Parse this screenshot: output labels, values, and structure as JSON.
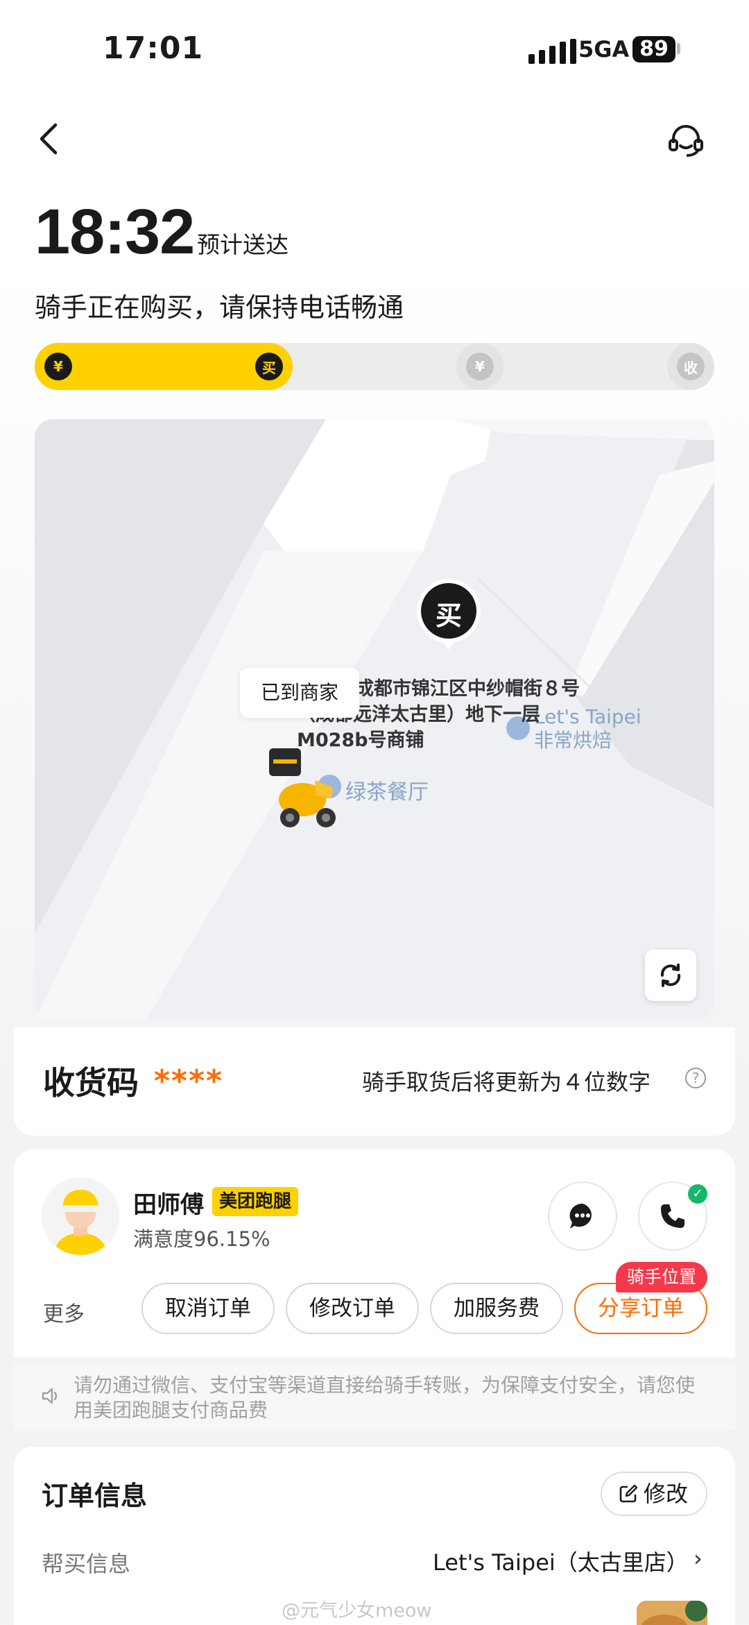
{
  "status_bar": {
    "time": "17:01",
    "network": "5GA",
    "battery": "89"
  },
  "header": {
    "eta_time": "18:32",
    "eta_label": "预计送达",
    "status": "骑手正在购买，请保持电话畅通"
  },
  "progress": {
    "steps": [
      {
        "glyph": "¥",
        "done": true
      },
      {
        "glyph": "买",
        "done": true
      },
      {
        "glyph": "¥",
        "done": false
      },
      {
        "glyph": "收",
        "done": false
      }
    ],
    "fraction_complete": 0.33
  },
  "map": {
    "pin_label": "买",
    "arrived_bubble": "已到商家",
    "address_lines": [
      "成都市锦江区中纱帽街８号",
      "（成都远洋太古里）地下一层",
      "M028b号商铺"
    ],
    "poi_1": [
      "Let's Taipei",
      "非常烘焙"
    ],
    "poi_2": "绿茶餐厅"
  },
  "receipt_code": {
    "title": "收货码",
    "code": "****",
    "hint": "骑手取货后将更新为４位数字",
    "help": "?"
  },
  "rider": {
    "name": "田师傅",
    "badge": "美团跑腿",
    "satisfaction": "满意度96.15%",
    "more_label": "更多",
    "actions": [
      "取消订单",
      "修改订单",
      "加服务费",
      "分享订单"
    ],
    "position_tag": "骑手位置"
  },
  "notice": {
    "text": "请勿通过微信、支付宝等渠道直接给骑手转账，为保障支付安全，请您使用美团跑腿支付商品费"
  },
  "order_info": {
    "title": "订单信息",
    "edit_label": "修改",
    "buy_info_label": "帮买信息",
    "buy_info_value": "Let's Taipei（太古里店）",
    "chevron": "›"
  },
  "watermark": "@元气少女meow",
  "colors": {
    "brand_yellow": "#ffd100",
    "accent_orange": "#ff6a00",
    "tag_red": "#f5394b",
    "verified_green": "#15b86a"
  }
}
